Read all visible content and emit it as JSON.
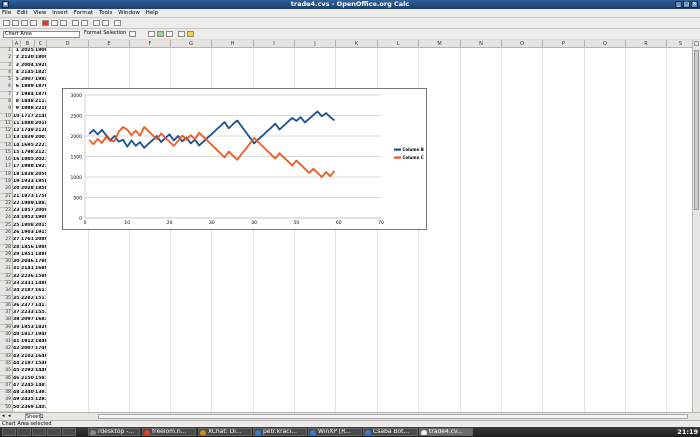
{
  "window": {
    "title": "trade4.cvs - OpenOffice.org Calc"
  },
  "menu": [
    "File",
    "Edit",
    "View",
    "Insert",
    "Format",
    "Tools",
    "Window",
    "Help"
  ],
  "toolbar2": {
    "name_box": "Chart Area",
    "format_selection": "Format Selection"
  },
  "columns": [
    "A",
    "B",
    "C",
    "D",
    "E",
    "F",
    "G",
    "H",
    "I",
    "J",
    "K",
    "L",
    "M",
    "N",
    "O",
    "P",
    "Q",
    "R",
    "S"
  ],
  "rows": [
    {
      "n": 1,
      "a": "1",
      "b": "2025",
      "c": "1900"
    },
    {
      "n": 2,
      "a": "2",
      "b": "2130",
      "c": "1800"
    },
    {
      "n": 3,
      "a": "3",
      "b": "2004",
      "c": "1928.2"
    },
    {
      "n": 4,
      "a": "4",
      "b": "2145",
      "c": "1825.7"
    },
    {
      "n": 5,
      "a": "5",
      "b": "2007",
      "c": "1984.1"
    },
    {
      "n": 6,
      "a": "6",
      "b": "1889",
      "c": "1876.1"
    },
    {
      "n": 7,
      "a": "7",
      "b": "1984",
      "c": "1876.2"
    },
    {
      "n": 8,
      "a": "8",
      "b": "1848",
      "c": "2113"
    },
    {
      "n": 9,
      "a": "9",
      "b": "1898",
      "c": "2218.8"
    },
    {
      "n": 10,
      "a": "10",
      "b": "1717",
      "c": "2148.8"
    },
    {
      "n": 11,
      "a": "11",
      "b": "1888",
      "c": "2018.8"
    },
    {
      "n": 12,
      "a": "12",
      "b": "1749",
      "c": "2128.7"
    },
    {
      "n": 13,
      "a": "13",
      "b": "1839",
      "c": "2007.7"
    },
    {
      "n": 14,
      "a": "14",
      "b": "1695",
      "c": "2221.5"
    },
    {
      "n": 15,
      "a": "15",
      "b": "1798",
      "c": "2121.5"
    },
    {
      "n": 16,
      "a": "16",
      "b": "1885",
      "c": "2021.5"
    },
    {
      "n": 17,
      "a": "17",
      "b": "1988",
      "c": "1921.5"
    },
    {
      "n": 18,
      "a": "18",
      "b": "1838",
      "c": "2058.4"
    },
    {
      "n": 19,
      "a": "19",
      "b": "1933",
      "c": "1958.4"
    },
    {
      "n": 20,
      "a": "20",
      "b": "2028",
      "c": "1858.4"
    },
    {
      "n": 21,
      "a": "21",
      "b": "1873",
      "c": "1758.4"
    },
    {
      "n": 22,
      "a": "22",
      "b": "1989",
      "c": "1883.7"
    },
    {
      "n": 23,
      "a": "23",
      "b": "1857",
      "c": "2009.1"
    },
    {
      "n": 24,
      "a": "24",
      "b": "1952",
      "c": "1909.1"
    },
    {
      "n": 25,
      "a": "25",
      "b": "1808",
      "c": "2015.5"
    },
    {
      "n": 26,
      "a": "26",
      "b": "1903",
      "c": "1915.5"
    },
    {
      "n": 27,
      "a": "27",
      "b": "1761",
      "c": "2080.8"
    },
    {
      "n": 28,
      "a": "28",
      "b": "1856",
      "c": "1980.8"
    },
    {
      "n": 29,
      "a": "29",
      "b": "1951",
      "c": "1880.8"
    },
    {
      "n": 30,
      "a": "30",
      "b": "2046",
      "c": "1780.8"
    },
    {
      "n": 31,
      "a": "31",
      "b": "2141",
      "c": "1680.8"
    },
    {
      "n": 32,
      "a": "32",
      "b": "2236",
      "c": "1580.8"
    },
    {
      "n": 33,
      "a": "33",
      "b": "2331",
      "c": "1480.8"
    },
    {
      "n": 34,
      "a": "34",
      "b": "2187",
      "c": "1617.6"
    },
    {
      "n": 35,
      "a": "35",
      "b": "2282",
      "c": "1517.6"
    },
    {
      "n": 36,
      "a": "36",
      "b": "2377",
      "c": "1417.6"
    },
    {
      "n": 37,
      "a": "37",
      "b": "2233",
      "c": "1557.4"
    },
    {
      "n": 38,
      "a": "38",
      "b": "2097",
      "c": "1683.6"
    },
    {
      "n": 39,
      "a": "39",
      "b": "1953",
      "c": "1820.4"
    },
    {
      "n": 40,
      "a": "40",
      "b": "1817",
      "c": "1946.6"
    },
    {
      "n": 41,
      "a": "41",
      "b": "1912",
      "c": "1846.6"
    },
    {
      "n": 42,
      "a": "42",
      "b": "2007",
      "c": "1746.6"
    },
    {
      "n": 43,
      "a": "43",
      "b": "2102",
      "c": "1646.6"
    },
    {
      "n": 44,
      "a": "44",
      "b": "2197",
      "c": "1546.6"
    },
    {
      "n": 45,
      "a": "45",
      "b": "2292",
      "c": "1446.6"
    },
    {
      "n": 46,
      "a": "46",
      "b": "2150",
      "c": "1581.5"
    },
    {
      "n": 47,
      "a": "47",
      "b": "2245",
      "c": "1481.5"
    },
    {
      "n": 48,
      "a": "48",
      "b": "2340",
      "c": "1381.5"
    },
    {
      "n": 49,
      "a": "49",
      "b": "2435",
      "c": "1281.5"
    },
    {
      "n": 50,
      "a": "50",
      "b": "2369",
      "c": "1401.2"
    }
  ],
  "chart_data": {
    "type": "line",
    "xlim": [
      0,
      70
    ],
    "ylim": [
      0,
      3000
    ],
    "xticks": [
      0,
      10,
      20,
      30,
      40,
      50,
      60,
      70
    ],
    "yticks": [
      0,
      500,
      1000,
      1500,
      2000,
      2500,
      3000
    ],
    "legend": "right",
    "series": [
      {
        "name": "Column B",
        "color": "#1f4e8c",
        "x": [
          1,
          2,
          3,
          4,
          5,
          6,
          7,
          8,
          9,
          10,
          11,
          12,
          13,
          14,
          15,
          16,
          17,
          18,
          19,
          20,
          21,
          22,
          23,
          24,
          25,
          26,
          27,
          28,
          29,
          30,
          31,
          32,
          33,
          34,
          35,
          36,
          37,
          38,
          39,
          40,
          41,
          42,
          43,
          44,
          45,
          46,
          47,
          48,
          49,
          50,
          51,
          52,
          53,
          54,
          55,
          56,
          57,
          58,
          59
        ],
        "y": [
          2050,
          2150,
          2040,
          2150,
          2020,
          1900,
          2000,
          1860,
          1910,
          1740,
          1890,
          1760,
          1850,
          1710,
          1810,
          1900,
          2000,
          1850,
          1950,
          2040,
          1890,
          2000,
          1870,
          1960,
          1820,
          1910,
          1770,
          1860,
          1960,
          2050,
          2150,
          2240,
          2340,
          2190,
          2290,
          2380,
          2240,
          2100,
          1960,
          1820,
          1920,
          2010,
          2110,
          2200,
          2300,
          2160,
          2250,
          2350,
          2440,
          2370,
          2460,
          2330,
          2420,
          2510,
          2600,
          2480,
          2560,
          2460,
          2380
        ]
      },
      {
        "name": "Column C",
        "color": "#ee5a24",
        "x": [
          1,
          2,
          3,
          4,
          5,
          6,
          7,
          8,
          9,
          10,
          11,
          12,
          13,
          14,
          15,
          16,
          17,
          18,
          19,
          20,
          21,
          22,
          23,
          24,
          25,
          26,
          27,
          28,
          29,
          30,
          31,
          32,
          33,
          34,
          35,
          36,
          37,
          38,
          39,
          40,
          41,
          42,
          43,
          44,
          45,
          46,
          47,
          48,
          49,
          50,
          51,
          52,
          53,
          54,
          55,
          56,
          57,
          58,
          59
        ],
        "y": [
          1900,
          1800,
          1930,
          1830,
          1980,
          1880,
          1880,
          2110,
          2220,
          2150,
          2020,
          2130,
          2010,
          2220,
          2120,
          2020,
          1920,
          2060,
          1960,
          1860,
          1760,
          1880,
          2010,
          1910,
          2020,
          1920,
          2080,
          1980,
          1880,
          1780,
          1680,
          1580,
          1480,
          1620,
          1520,
          1420,
          1560,
          1680,
          1820,
          1950,
          1850,
          1750,
          1650,
          1550,
          1450,
          1580,
          1480,
          1380,
          1280,
          1400,
          1300,
          1200,
          1100,
          1200,
          1100,
          1000,
          1120,
          1020,
          1150
        ]
      }
    ]
  },
  "sheetbar": {
    "tab": "Sheet1"
  },
  "status": {
    "text": "Chart Area selected"
  },
  "taskbar": {
    "items": [
      {
        "label": "rdesktop -...",
        "color": "#888"
      },
      {
        "label": "freelom.n...",
        "color": "#e04020"
      },
      {
        "label": "XChat: Di...",
        "color": "#d09020"
      },
      {
        "label": "petr.kraci...",
        "color": "#3a7ad0"
      },
      {
        "label": "WinXP [R...",
        "color": "#3a7ad0"
      },
      {
        "label": "Csaba Bot...",
        "color": "#3a7ad0"
      },
      {
        "label": "trade4.cv...",
        "color": "#eee"
      }
    ],
    "clock": "21:19"
  }
}
